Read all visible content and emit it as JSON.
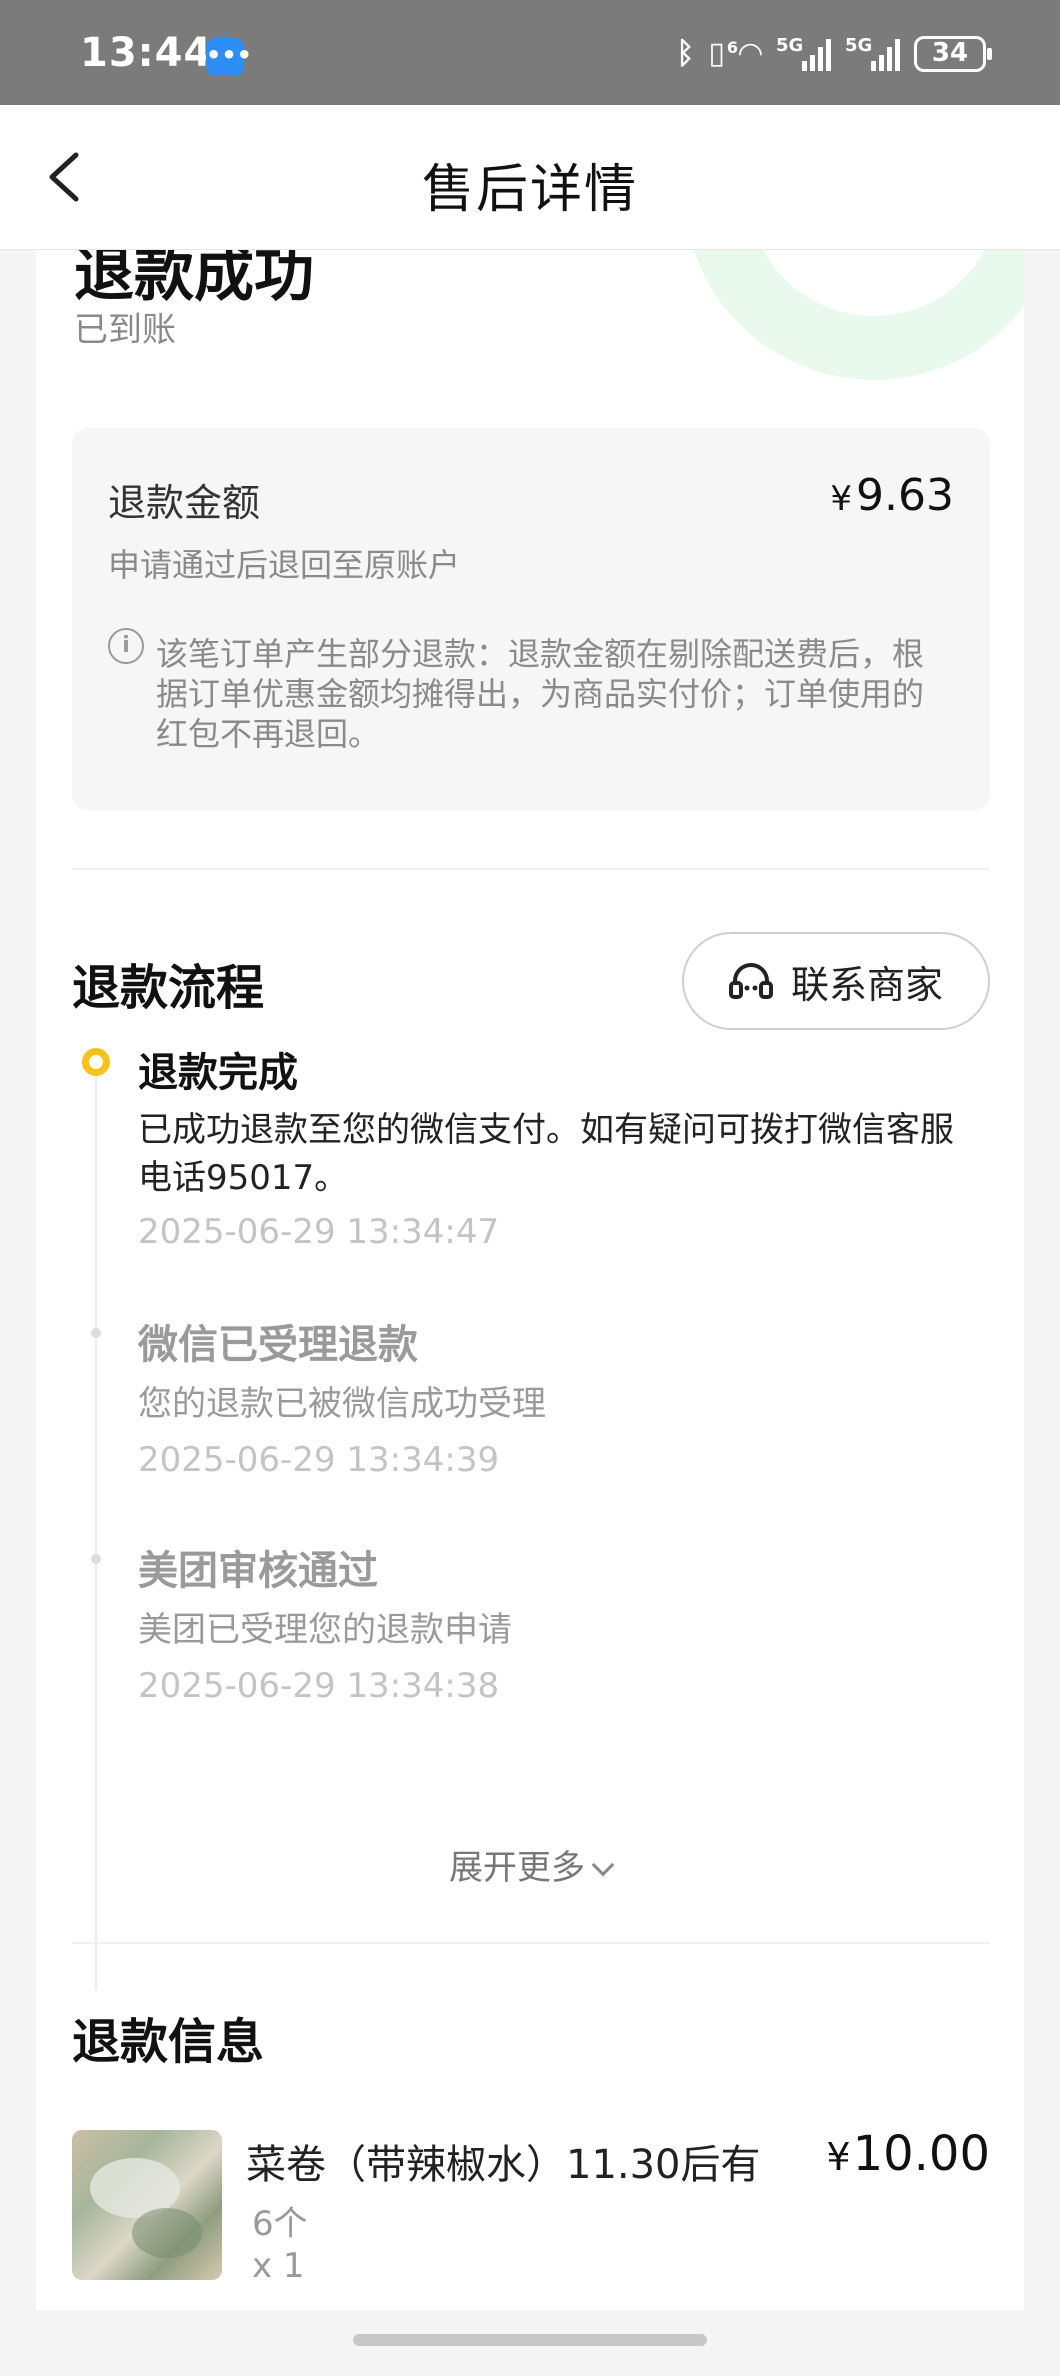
{
  "status_bar": {
    "time": "13:44",
    "msg_icon": "message-bubble-icon",
    "net_label_1": "5G",
    "net_label_2": "5G",
    "wifi_badge": "6",
    "battery": "34"
  },
  "nav": {
    "title": "售后详情",
    "back_icon": "chevron-left-icon"
  },
  "status": {
    "title": "退款成功",
    "subtitle": "已到账",
    "accent_color": "#eaf9ee"
  },
  "refund_amount": {
    "label": "退款金额",
    "currency": "¥",
    "value": "9.63",
    "note": "申请通过后退回至原账户",
    "info": "该笔订单产生部分退款：退款金额在剔除配送费后，根据订单优惠金额均摊得出，为商品实付价；订单使用的红包不再退回。"
  },
  "process": {
    "title": "退款流程",
    "contact_button": "联系商家",
    "active_color": "#f7c21a",
    "steps": [
      {
        "title": "退款完成",
        "desc": "已成功退款至您的微信支付。如有疑问可拨打微信客服电话95017。",
        "time": "2025-06-29 13:34:47"
      },
      {
        "title": "微信已受理退款",
        "desc": "您的退款已被微信成功受理",
        "time": "2025-06-29 13:34:39"
      },
      {
        "title": "美团审核通过",
        "desc": "美团已受理您的退款申请",
        "time": "2025-06-29 13:34:38"
      }
    ],
    "expand_label": "展开更多"
  },
  "refund_info": {
    "title": "退款信息",
    "item": {
      "name": "菜卷（带辣椒水）11.30后有",
      "spec": "6个",
      "qty": "x 1",
      "currency": "¥",
      "price": "10.00"
    }
  }
}
